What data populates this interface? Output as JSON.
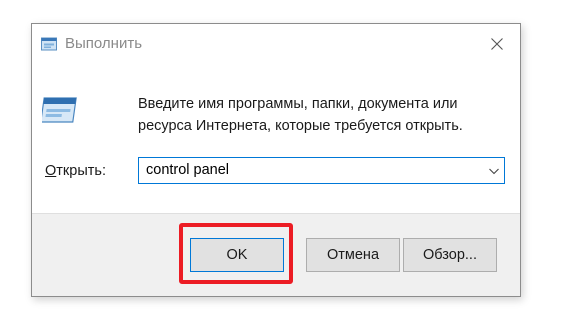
{
  "window": {
    "title": "Выполнить",
    "title_icon": "run-app-icon",
    "close_icon": "close-icon"
  },
  "content": {
    "icon": "run-dialog-icon",
    "description": "Введите имя программы, папки, документа или ресурса Интернета, которые требуется открыть.",
    "open_label_accel": "О",
    "open_label_rest": "ткрыть:",
    "command_value": "control panel",
    "dropdown_icon": "chevron-down-icon"
  },
  "buttons": {
    "ok": "OK",
    "cancel": "Отмена",
    "browse": "Обзор..."
  },
  "colors": {
    "accent": "#0078d7",
    "highlight": "#ec1c24",
    "footer_bg": "#f0f0f0"
  }
}
